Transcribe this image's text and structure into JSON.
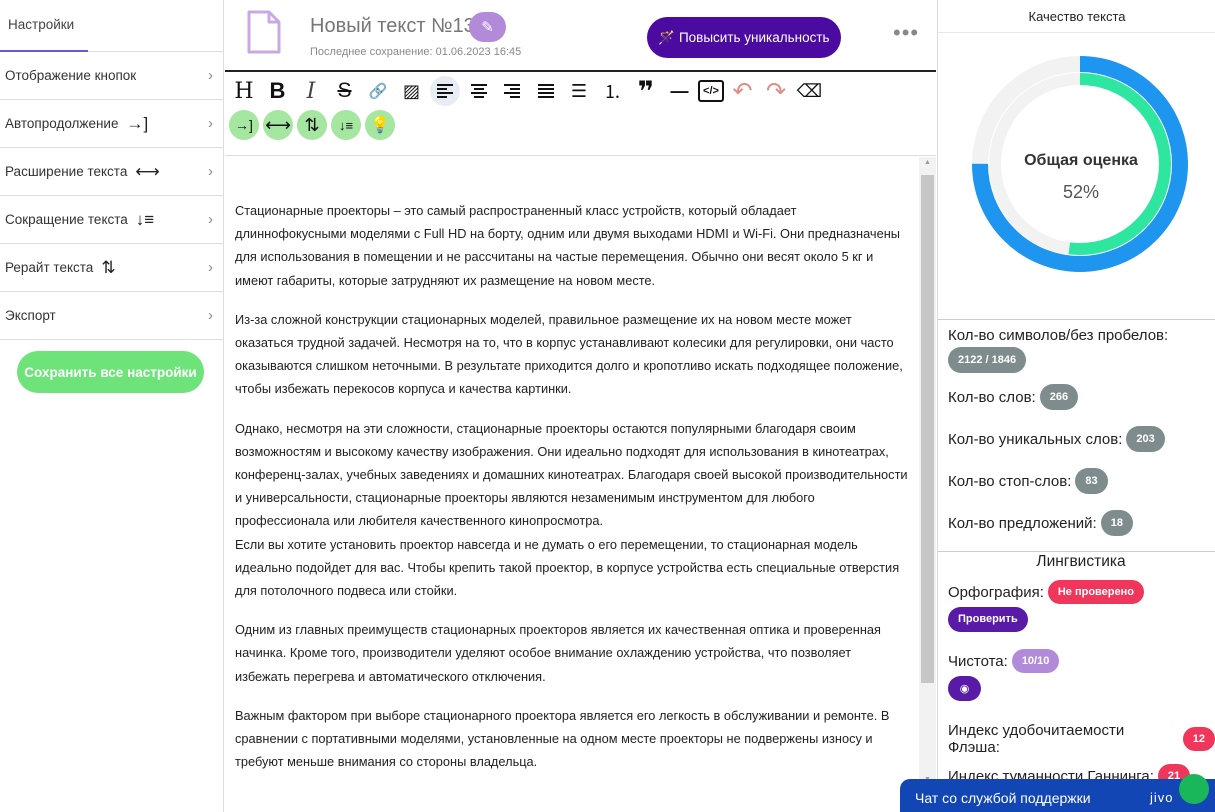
{
  "sidebar": {
    "tab_label": "Настройки",
    "items": [
      {
        "label": "Отображение кнопок",
        "icon": "",
        "icon_name": ""
      },
      {
        "label": "Автопродолжение",
        "icon": "→]",
        "icon_name": "autocontinue-icon"
      },
      {
        "label": "Расширение текста",
        "icon": "⟷",
        "icon_name": "expand-icon"
      },
      {
        "label": "Сокращение текста",
        "icon": "↓≡",
        "icon_name": "shorten-icon"
      },
      {
        "label": "Рерайт текста",
        "icon": "⇅",
        "icon_name": "rewrite-icon"
      },
      {
        "label": "Экспорт",
        "icon": "",
        "icon_name": ""
      }
    ],
    "save_label": "Сохранить все настройки"
  },
  "header": {
    "title": "Новый текст №13",
    "last_saved": "Последнее сохранение: 01.06.2023 16:45",
    "unique_button": "🪄 Повысить уникальность",
    "more": "•••"
  },
  "toolbar": {
    "row1": [
      {
        "glyph": "H",
        "name": "heading-icon"
      },
      {
        "glyph": "B",
        "name": "bold-icon"
      },
      {
        "glyph": "I",
        "name": "italic-icon"
      },
      {
        "glyph": "S",
        "name": "strikethrough-icon"
      },
      {
        "glyph": "🔗",
        "name": "link-icon"
      },
      {
        "glyph": "▨",
        "name": "image-icon"
      },
      {
        "glyph": "≡",
        "name": "align-left-icon"
      },
      {
        "glyph": "≡",
        "name": "align-center-icon"
      },
      {
        "glyph": "≡",
        "name": "align-right-icon"
      },
      {
        "glyph": "≡",
        "name": "align-justify-icon"
      },
      {
        "glyph": "☰",
        "name": "bullet-list-icon"
      },
      {
        "glyph": "⒈",
        "name": "numbered-list-icon"
      },
      {
        "glyph": "❞",
        "name": "quote-icon"
      },
      {
        "glyph": "—",
        "name": "horizontal-rule-icon"
      },
      {
        "glyph": "</>",
        "name": "code-icon"
      },
      {
        "glyph": "↶",
        "name": "undo-icon"
      },
      {
        "glyph": "↷",
        "name": "redo-icon"
      },
      {
        "glyph": "⌫",
        "name": "eraser-icon"
      }
    ],
    "row2": [
      {
        "glyph": "→]",
        "name": "autocontinue-icon"
      },
      {
        "glyph": "⟷",
        "name": "expand-icon"
      },
      {
        "glyph": "⇅",
        "name": "rewrite-icon"
      },
      {
        "glyph": "↓≡",
        "name": "shorten-icon"
      },
      {
        "glyph": "💡",
        "name": "lightbulb-icon"
      }
    ]
  },
  "editor": {
    "paragraphs": [
      "Стационарные проекторы – это самый распространенный класс устройств, который обладает длиннофокусными моделями с Full HD на борту, одним или двумя выходами HDMI и Wi-Fi. Они предназначены для использования в помещении и не рассчитаны на частые перемещения. Обычно они весят около 5 кг и имеют габариты, которые затрудняют их размещение на новом месте.",
      "Из-за сложной конструкции стационарных моделей, правильное размещение их на новом месте может оказаться трудной задачей. Несмотря на то, что в корпус устанавливают колесики для регулировки, они часто оказываются слишком неточными. В результате приходится долго и кропотливо искать подходящее положение, чтобы избежать перекосов корпуса и качества картинки.",
      "Однако, несмотря на эти сложности, стационарные проекторы остаются популярными благодаря своим возможностям и высокому качеству изображения. Они идеально подходят для использования в кинотеатрах, конференц-залах, учебных заведениях и домашних кинотеатрах. Благодаря своей высокой производительности и универсальности, стационарные проекторы являются незаменимым инструментом для любого профессионала или любителя качественного кинопросмотра.\nЕсли вы хотите установить проектор навсегда и не думать о его перемещении, то стационарная модель идеально подойдет для вас. Чтобы крепить такой проектор, в корпусе устройства есть специальные отверстия для потолочного подвеса или стойки.",
      "Одним из главных преимуществ стационарных проекторов является их качественная оптика и проверенная начинка. Кроме того, производители уделяют особое внимание охлаждению устройства, что позволяет избежать перегрева и автоматического отключения.",
      "Важным фактором при выборе стационарного проектора является его легкость в обслуживании и ремонте. В сравнении с портативными моделями, установленные на одном месте проекторы не подвержены износу и требуют меньше внимания со стороны владельца."
    ]
  },
  "quality": {
    "title": "Качество текста",
    "gauge_title": "Общая оценка",
    "gauge_value": "52%",
    "outer_fraction": 0.75,
    "inner_fraction": 0.52,
    "colors": {
      "outer": "#1e96f0",
      "inner": "#2ee6a0",
      "track": "#f2f2f2"
    }
  },
  "stats": [
    {
      "label": "Кол-во символов/без пробелов:",
      "value": "2122 / 1846"
    },
    {
      "label": "Кол-во слов:",
      "value": "266"
    },
    {
      "label": "Кол-во уникальных слов:",
      "value": "203"
    },
    {
      "label": "Кол-во стоп-слов:",
      "value": "83"
    },
    {
      "label": "Кол-во предложений:",
      "value": "18"
    }
  ],
  "linguistics": {
    "title": "Лингвистика",
    "spelling_label": "Орфография:",
    "spelling_status": "Не проверено",
    "check_button": "Проверить",
    "purity_label": "Чистота:",
    "purity_value": "10/10",
    "flesch_label": "Индекс удобочитаемости Флэша:",
    "flesch_value": "12",
    "gunning_label": "Индекс туманности Ганнинга:",
    "gunning_value": "21"
  },
  "chat": {
    "label": "Чат со службой поддержки",
    "brand": "jivo"
  }
}
